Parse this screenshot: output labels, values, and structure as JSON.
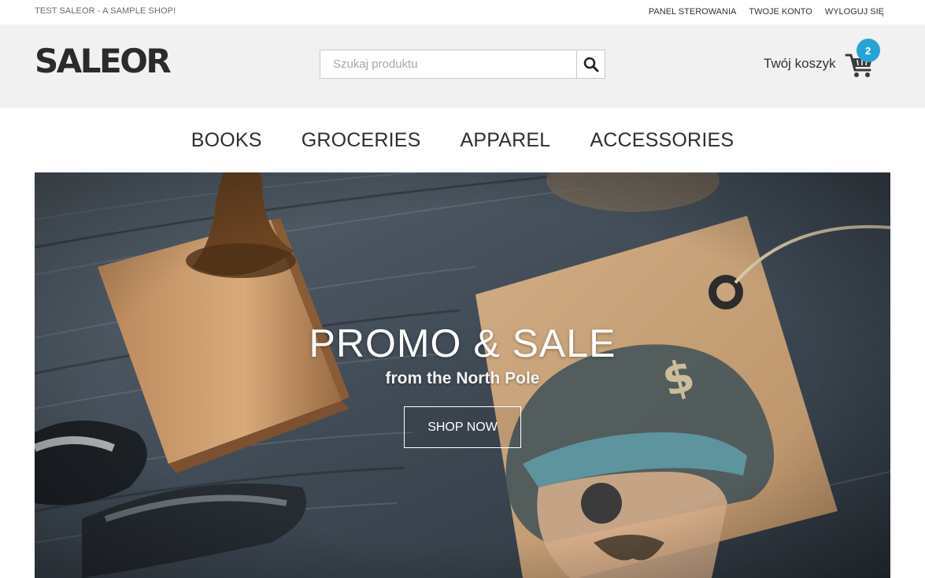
{
  "topbar": {
    "shop_name": "TEST SALEOR - A SAMPLE SHOP!",
    "links": [
      "PANEL STEROWANIA",
      "TWOJE KONTO",
      "WYLOGUJ SIĘ"
    ]
  },
  "header": {
    "logo": "SALEOR",
    "search": {
      "placeholder": "Szukaj produktu",
      "value": "",
      "icon": "search-icon"
    },
    "cart": {
      "label": "Twój koszyk",
      "count": "2",
      "icon": "cart-icon",
      "badge_color": "#26a5d4"
    }
  },
  "nav": {
    "items": [
      "BOOKS",
      "GROCERIES",
      "APPAREL",
      "ACCESSORIES"
    ]
  },
  "hero": {
    "title": "PROMO & SALE",
    "subtitle": "from the North Pole",
    "button": "SHOP NOW"
  },
  "colors": {
    "header_bg": "#f1f1f1",
    "accent": "#26a5d4",
    "text": "#333333"
  }
}
